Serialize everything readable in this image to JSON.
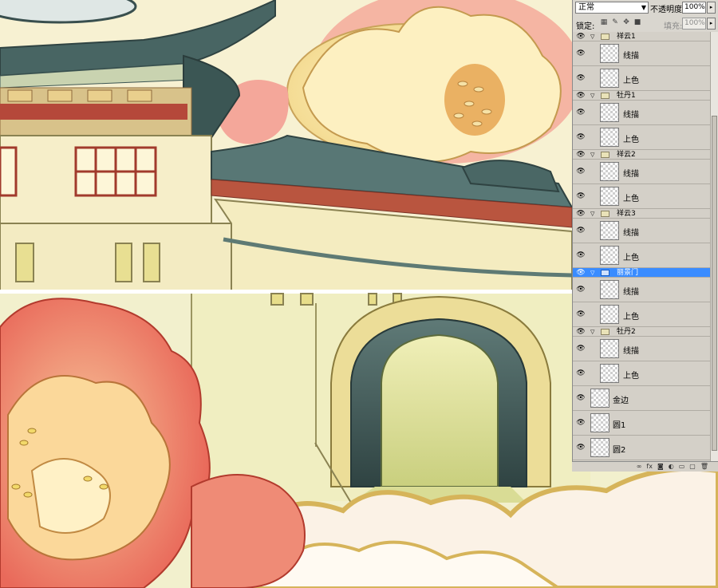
{
  "panel": {
    "blend_mode": "正常",
    "opacity_label": "不透明度:",
    "opacity_value": "100%",
    "lock_label": "锁定:",
    "fill_label": "填充:",
    "fill_value": "100%"
  },
  "layers": [
    {
      "kind": "group",
      "name": "祥云1"
    },
    {
      "kind": "leaf",
      "name": "线描"
    },
    {
      "kind": "leaf",
      "name": "上色"
    },
    {
      "kind": "group",
      "name": "牡丹1"
    },
    {
      "kind": "leaf",
      "name": "线描"
    },
    {
      "kind": "leaf",
      "name": "上色"
    },
    {
      "kind": "group",
      "name": "祥云2"
    },
    {
      "kind": "leaf",
      "name": "线描"
    },
    {
      "kind": "leaf",
      "name": "上色"
    },
    {
      "kind": "group",
      "name": "祥云3"
    },
    {
      "kind": "leaf",
      "name": "线描"
    },
    {
      "kind": "leaf",
      "name": "上色"
    },
    {
      "kind": "group",
      "name": "丽景门",
      "selected": true
    },
    {
      "kind": "leaf",
      "name": "线描"
    },
    {
      "kind": "leaf",
      "name": "上色"
    },
    {
      "kind": "group",
      "name": "牡丹2"
    },
    {
      "kind": "leaf",
      "name": "线描"
    },
    {
      "kind": "leaf",
      "name": "上色"
    },
    {
      "kind": "top",
      "name": "金边"
    },
    {
      "kind": "top",
      "name": "圆1"
    },
    {
      "kind": "top",
      "name": "圆2"
    }
  ],
  "icons": {
    "eye": "eye-icon",
    "lock": [
      "lock-transparent-icon",
      "lock-paint-icon",
      "lock-move-icon",
      "lock-all-icon"
    ],
    "footer": [
      "link-icon",
      "fx-icon",
      "mask-icon",
      "adjustment-icon",
      "new-group-icon",
      "new-layer-icon",
      "trash-icon"
    ]
  },
  "colors": {
    "selection": "#3a8cff",
    "panel_bg": "#d4d0c8",
    "canvas_bg": "#f3f0d8"
  }
}
